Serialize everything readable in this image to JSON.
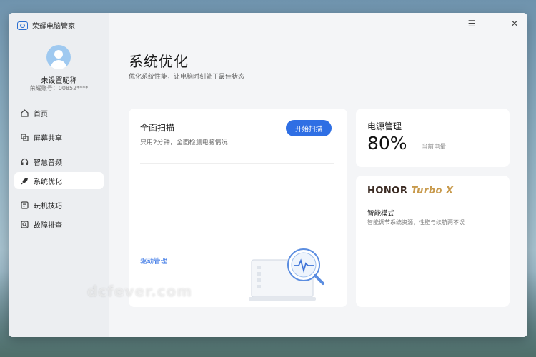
{
  "app": {
    "name": "荣耀电脑管家"
  },
  "user": {
    "nickname": "未设置昵称",
    "account": "荣耀账号：00852****"
  },
  "sidebar": {
    "items": [
      {
        "label": "首页",
        "icon": "home-icon"
      },
      {
        "label": "屏幕共享",
        "icon": "screen-share-icon"
      },
      {
        "label": "智慧音频",
        "icon": "headphones-icon"
      },
      {
        "label": "系统优化",
        "icon": "rocket-icon",
        "active": true
      },
      {
        "label": "玩机技巧",
        "icon": "tips-icon"
      },
      {
        "label": "故障排查",
        "icon": "troubleshoot-icon"
      }
    ]
  },
  "window_controls": {
    "menu": "☰",
    "minimize": "—",
    "close": "✕"
  },
  "page": {
    "title": "系统优化",
    "subtitle": "优化系统性能，让电脑时刻处于最佳状态"
  },
  "scan": {
    "title": "全面扫描",
    "description": "只用2分钟，全面检测电脑情况",
    "button": "开始扫描",
    "driver_link": "驱动管理"
  },
  "power": {
    "title": "电源管理",
    "value": "80%",
    "label": "当前电量"
  },
  "turbo": {
    "brand": "HONOR",
    "model": "Turbo X",
    "mode": "智能模式",
    "description": "智能调节系统资源，性能与续航两不误"
  },
  "watermark": "dcfever.com",
  "colors": {
    "accent": "#2f6fe4",
    "turbo_gold": "#c89a4c"
  }
}
